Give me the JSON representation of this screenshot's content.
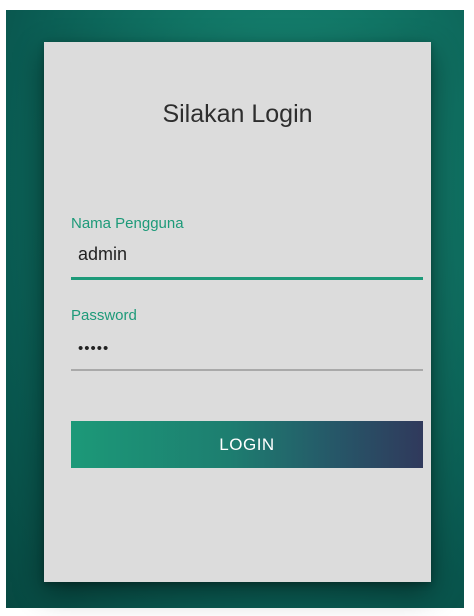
{
  "login": {
    "title": "Silakan Login",
    "username": {
      "label": "Nama Pengguna",
      "value": "admin"
    },
    "password": {
      "label": "Password",
      "value": "•••••"
    },
    "button_label": "LOGIN"
  },
  "colors": {
    "accent": "#1d9a79",
    "background": "#0c5f56",
    "card": "#dcdcdc",
    "button_gradient_start": "#1c9978",
    "button_gradient_end": "#30395c"
  }
}
